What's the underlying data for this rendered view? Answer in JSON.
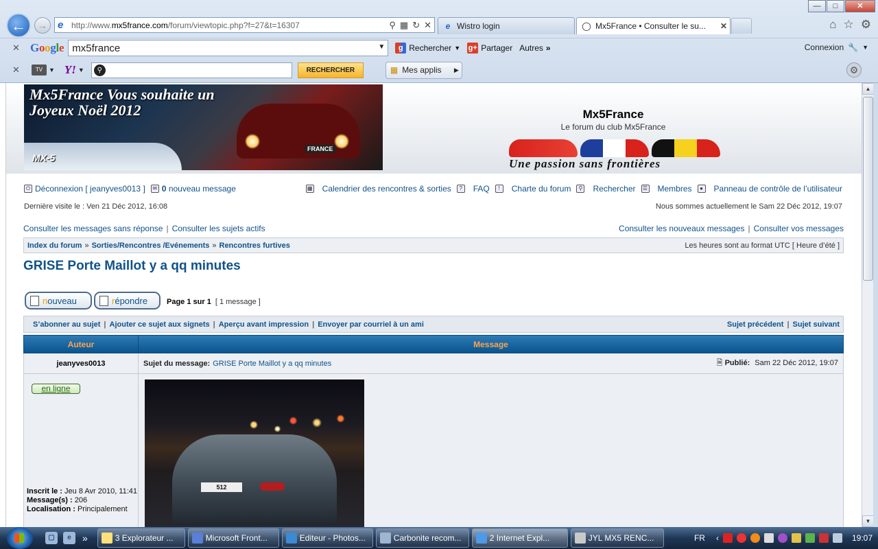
{
  "browser": {
    "address_host": "mx5france.com",
    "address_prefix": "http://www.",
    "address_path": "/forum/viewtopic.php?f=27&t=16307",
    "tabs": [
      {
        "label": "Wistro login"
      },
      {
        "label": "Mx5France • Consulter le su..."
      }
    ],
    "window_controls": {
      "minimize": "—",
      "maximize": "□",
      "close": "✕"
    },
    "google_toolbar": {
      "logo": "Google",
      "search_value": "mx5france",
      "rechercher": "Rechercher",
      "partager": "Partager",
      "autres": "Autres",
      "connexion": "Connexion"
    },
    "yahoo_toolbar": {
      "logo": "Y!",
      "search_value": "",
      "button": "RECHERCHER",
      "mes_applis": "Mes applis"
    }
  },
  "forum": {
    "banner_text": "Mx5France Vous souhaite un Joyeux Noël 2012",
    "banner_logo": "MX-5",
    "banner_logo_sub": "FRANCE",
    "site_name": "Mx5France",
    "site_desc": "Le forum du club Mx5France",
    "slogan": "Une passion sans frontières",
    "nav": {
      "deconnexion": "Déconnexion [ jeanyves0013 ]",
      "new_count": "0",
      "new_messages": "nouveau message",
      "calendrier": "Calendrier des rencontres & sorties",
      "faq": "FAQ",
      "charte": "Charte du forum",
      "rechercher": "Rechercher",
      "membres": "Membres",
      "panneau": "Panneau de contrôle de l’utilisateur"
    },
    "last_visit": "Dernière visite le : Ven 21 Déc 2012, 16:08",
    "now": "Nous sommes actuellement le Sam 22 Déc 2012, 19:07",
    "quick": {
      "sans_reponse": "Consulter les messages sans réponse",
      "actifs": "Consulter les sujets actifs",
      "nouveaux": "Consulter les nouveaux messages",
      "vos_messages": "Consulter vos messages"
    },
    "breadcrumb": [
      "Index du forum",
      "Sorties/Rencontres /Evénements",
      "Rencontres furtives"
    ],
    "breadcrumb_sep": "»",
    "timezone": "Les heures sont au format UTC [ Heure d’été ]",
    "topic_title": "GRISE Porte Maillot y a qq minutes",
    "btn_new_first": "n",
    "btn_new_rest": "ouveau",
    "btn_reply_first": "r",
    "btn_reply_rest": "épondre",
    "pagination": "Page 1 sur 1",
    "message_count": "[ 1 message ]",
    "actions": {
      "abonner": "S’abonner au sujet",
      "signets": "Ajouter ce sujet aux signets",
      "apercu": "Aperçu avant impression",
      "envoyer": "Envoyer par courriel à un ami",
      "precedent": "Sujet précédent",
      "suivant": "Sujet suivant"
    },
    "table_headers": {
      "author": "Auteur",
      "message": "Message"
    },
    "post": {
      "author": "jeanyves0013",
      "subject_label": "Sujet du message:",
      "subject": "GRISE Porte Maillot y a qq minutes",
      "posted_label": "Publié:",
      "posted": "Sam 22 Déc 2012, 19:07",
      "online": "en ligne",
      "inscrit_label": "Inscrit le :",
      "inscrit": "Jeu 8 Avr 2010, 11:41",
      "messages_label": "Message(s) :",
      "messages": "206",
      "localisation_label": "Localisation :",
      "localisation": "Principalement",
      "plate": "512"
    }
  },
  "taskbar": {
    "tasks": [
      {
        "label": "3 Explorateur ..."
      },
      {
        "label": "Microsoft Front..."
      },
      {
        "label": "Editeur - Photos..."
      },
      {
        "label": "Carbonite recom..."
      },
      {
        "label": "2 Internet Expl..."
      },
      {
        "label": "JYL   MX5   RENC..."
      }
    ],
    "lang": "FR",
    "clock": "19:07"
  },
  "colors": {
    "link": "#105289",
    "header_orange": "#ffa34f",
    "table_head": "#0a5590"
  }
}
